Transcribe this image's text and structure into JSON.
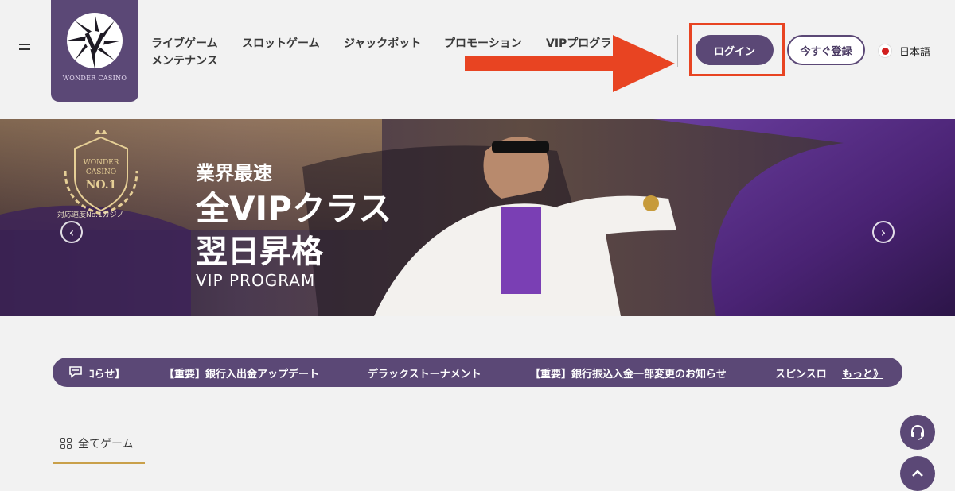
{
  "header": {
    "logo_text": "WONDER CASINO",
    "nav": [
      {
        "label": "ライブゲーム"
      },
      {
        "label": "スロットゲーム"
      },
      {
        "label": "ジャックポット"
      },
      {
        "label": "プロモーション"
      },
      {
        "label": "VIPプログラ"
      },
      {
        "label": "メンテナンス"
      }
    ],
    "login_label": "ログイン",
    "register_label": "今すぐ登録",
    "language_label": "日本語"
  },
  "banner": {
    "badge_lines": [
      "WONDER",
      "CASINO",
      "NO.1"
    ],
    "badge_caption": "対応速度No.1カジノ",
    "line1": "業界最速",
    "line2": "全VIPクラス",
    "line3": "翌日昇格",
    "line4": "VIP PROGRAM"
  },
  "ticker": {
    "items": [
      {
        "label": "ｺらせ】"
      },
      {
        "label": "【重要】銀行入出金アップデート"
      },
      {
        "label": "デラックストーナメント"
      },
      {
        "label": "【重要】銀行振込入金一部変更のお知らせ"
      },
      {
        "label": "スピンスロ"
      }
    ],
    "more_label": "もっと》"
  },
  "tabs": {
    "all_games_label": "全てゲーム"
  },
  "colors": {
    "brand_purple": "#5b4876",
    "annotation_red": "#e84422",
    "tab_underline_gold": "#c9a04a"
  },
  "icons": {
    "menu": "hamburger-icon",
    "flag": "japan-flag-icon",
    "ticker": "chat-icon",
    "tab": "grid-icon",
    "support": "headset-icon",
    "top": "chevron-up-icon"
  }
}
